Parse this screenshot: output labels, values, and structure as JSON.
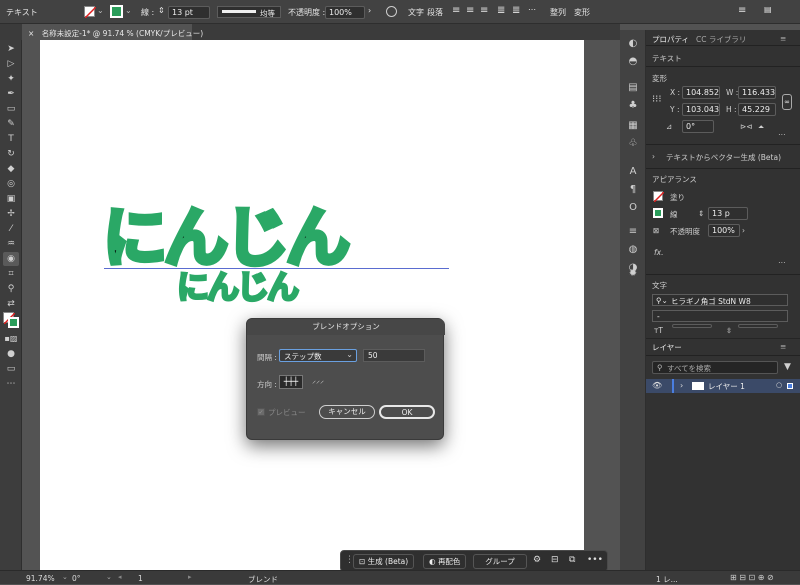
{
  "control_bar": {
    "selection_label": "テキスト",
    "stroke_label": "線 :",
    "stroke_weight": "13 pt",
    "stroke_profile": "均等",
    "opacity_label": "不透明度 :",
    "opacity_value": "100%",
    "char_label": "文字",
    "para_label": "段落",
    "align_label": "整列",
    "transform_label": "変形"
  },
  "document_tab": {
    "title": "名称未設定-1* @ 91.74 % (CMYK/プレビュー)",
    "close": "×"
  },
  "artwork": {
    "main_text": "にんじん",
    "blend_text": "にんじん",
    "fill_color": "#000000",
    "stroke_color": "#22a85f"
  },
  "blend_dialog": {
    "title": "ブレンドオプション",
    "spacing_label": "間隔 :",
    "spacing_value": "ステップ数",
    "steps_value": "50",
    "orientation_label": "方向 :",
    "preview_label": "プレビュー",
    "cancel_label": "キャンセル",
    "ok_label": "OK"
  },
  "properties_panel": {
    "tab_properties": "プロパティ",
    "tab_cc_libraries": "CC ライブラリ",
    "section_text": "テキスト",
    "section_transform": "変形",
    "x_label": "X :",
    "x_value": "104.852",
    "w_label": "W :",
    "w_value": "116.433",
    "y_label": "Y :",
    "y_value": "103.043",
    "h_label": "H :",
    "h_value": "45.229",
    "rotate_value": "0°",
    "vector_gen_label": "テキストからベクター生成 (Beta)",
    "appearance_label": "アピアランス",
    "fill_label": "塗り",
    "stroke_label": "線",
    "stroke_value": "13 p",
    "opacity_label": "不透明度",
    "opacity_value": "100%",
    "fx_label": "fx.",
    "character_label": "文字",
    "font_name": "ヒラギノ角ゴ StdN W8",
    "font_style": "-"
  },
  "layers_panel": {
    "tab_label": "レイヤー",
    "search_placeholder": "すべてを検索",
    "layer_name": "レイヤー 1"
  },
  "context_bar": {
    "generate_label": "生成 (Beta)",
    "recolor_label": "再配色",
    "group_label": "グループ",
    "more": "•••"
  },
  "status_bar": {
    "zoom": "91.74%",
    "rotation": "0°",
    "artboard_num": "1",
    "tool_name": "ブレンド",
    "layers_count": "1 レ..."
  }
}
